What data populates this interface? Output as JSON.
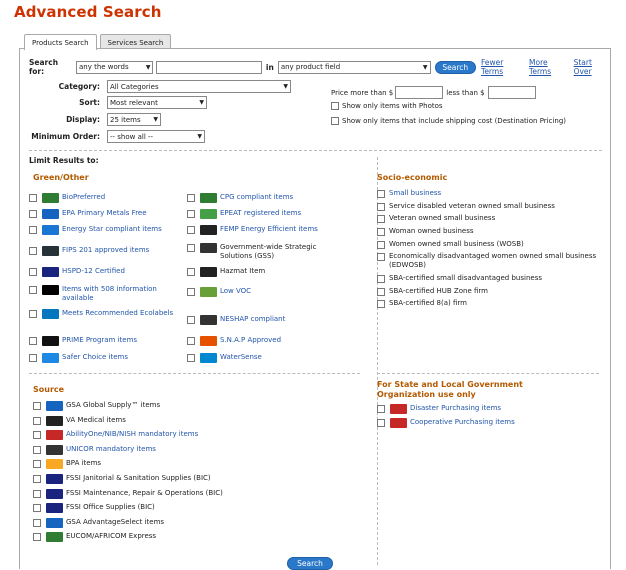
{
  "page_title": "Advanced Search",
  "tabs": [
    "Products Search",
    "Services Search"
  ],
  "search": {
    "label": "Search for:",
    "words_select": "any the words",
    "in_label": "in",
    "field_select": "any product field",
    "button": "Search",
    "links": [
      "Fewer Terms",
      "More Terms",
      "Start Over"
    ]
  },
  "filters": {
    "category_label": "Category:",
    "category_value": "All Categories",
    "sort_label": "Sort:",
    "sort_value": "Most relevant",
    "display_label": "Display:",
    "display_value": "25 items",
    "min_order_label": "Minimum Order:",
    "min_order_value": "-- show all --"
  },
  "price": {
    "more_label": "Price more than $",
    "less_label": "less than $",
    "photos": "Show only items with Photos",
    "shipping": "Show only items that include shipping cost (Destination Pricing)"
  },
  "limit_label": "Limit Results to:",
  "green": {
    "heading": "Green/Other",
    "left": [
      {
        "icon": "BP",
        "label": "BioPreferred"
      },
      {
        "icon": "EPA",
        "label": "EPA Primary Metals Free"
      },
      {
        "icon": "ES",
        "label": "Energy Star compliant items"
      },
      {
        "icon": "FIPS",
        "label": "FIPS 201 approved items"
      },
      {
        "icon": "HSPD",
        "label": "HSPD-12 Certified"
      },
      {
        "icon": "508",
        "label": "Items with 508 information available"
      },
      {
        "icon": "MR",
        "label": "Meets Recommended Ecolabels"
      },
      {
        "icon": "PRIME",
        "label": "PRIME Program items"
      },
      {
        "icon": "SC",
        "label": "Safer Choice items"
      }
    ],
    "right": [
      {
        "icon": "CPG",
        "label": "CPG compliant items"
      },
      {
        "icon": "EP",
        "label": "EPEAT registered items"
      },
      {
        "icon": "FEMP",
        "label": "FEMP Energy Efficient items"
      },
      {
        "icon": "GSS",
        "label": "Government-wide Strategic Solutions (GSS)"
      },
      {
        "icon": "HZ",
        "label": "Hazmat Item"
      },
      {
        "icon": "VOC",
        "label": "Low VOC"
      },
      {
        "icon": "NES",
        "label": "NESHAP compliant"
      },
      {
        "icon": "SNAP",
        "label": "S.N.A.P Approved"
      },
      {
        "icon": "WS",
        "label": "WaterSense"
      }
    ]
  },
  "socio": {
    "heading": "Socio-economic",
    "items": [
      "Small business",
      "Service disabled veteran owned small business",
      "Veteran owned small business",
      "Woman owned business",
      "Women owned small business (WOSB)",
      "Economically disadvantaged women owned small business (EDWOSB)",
      "SBA-certified small disadvantaged business",
      "SBA-certified HUB Zone firm",
      "SBA-certified 8(a) firm"
    ]
  },
  "source": {
    "heading": "Source",
    "items": [
      {
        "icon": "GSA",
        "label": "GSA Global Supply™ items"
      },
      {
        "icon": "VA",
        "label": "VA Medical items"
      },
      {
        "icon": "AO",
        "label": "AbilityOne/NIB/NISH mandatory items"
      },
      {
        "icon": "UNI",
        "label": "UNICOR mandatory items"
      },
      {
        "icon": "BPA",
        "label": "BPA items"
      },
      {
        "icon": "FSSI",
        "label": "FSSI Janitorial & Sanitation Supplies (BIC)"
      },
      {
        "icon": "FSSI",
        "label": "FSSI Maintenance, Repair & Operations (BIC)"
      },
      {
        "icon": "FSSI",
        "label": "FSSI Office Supplies (BIC)"
      },
      {
        "icon": "AS",
        "label": "GSA AdvantageSelect items"
      },
      {
        "icon": "EUC",
        "label": "EUCOM/AFRICOM Express"
      }
    ]
  },
  "state": {
    "heading": "For State and Local Government Organization use only",
    "items": [
      {
        "icon": "DR",
        "label": "Disaster Purchasing items"
      },
      {
        "icon": "CP",
        "label": "Cooperative Purchasing items"
      }
    ]
  },
  "bottom_button": "Search"
}
